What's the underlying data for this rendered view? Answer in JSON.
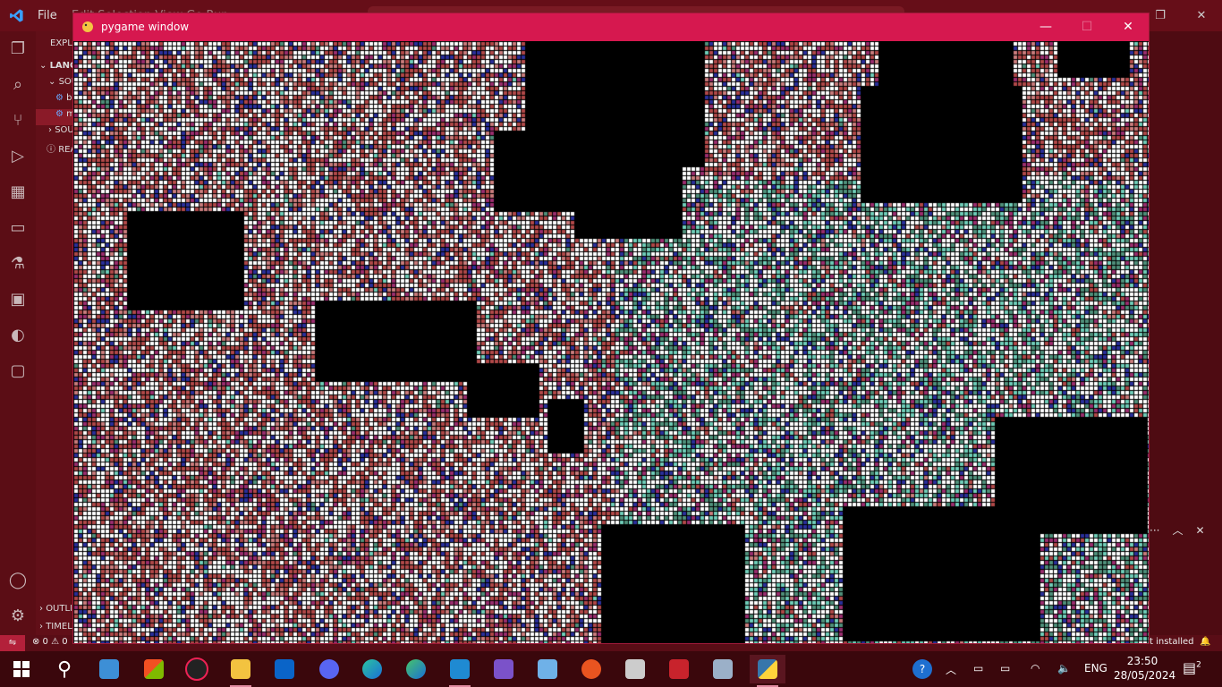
{
  "vscode": {
    "menu_file": "File",
    "menu_hint": "Edit  Selection  View  Go  Run",
    "sidebar": {
      "explorer_label": "EXPLO",
      "section_label": "LANG",
      "rows": [
        "SOU",
        "b",
        "m",
        "SOU",
        "REA"
      ],
      "outline": "OUTLI",
      "timeline": "TIMEL"
    },
    "status": {
      "problems": "⊗ 0 ⚠ 0",
      "right_text": "t installed"
    }
  },
  "pygame": {
    "title": "pygame window",
    "controls": {
      "minimize": "—",
      "maximize": "☐",
      "close": "✕"
    }
  },
  "taskbar": {
    "tray_lang": "ENG",
    "time": "23:50",
    "date": "28/05/2024",
    "notification_count": "2"
  },
  "colors": {
    "pygame_titlebar": "#d6184f",
    "vscode_theme": "#610f18",
    "cell_black": "#000000",
    "cell_red": "#b04848",
    "cell_blue": "#2a2f9a",
    "cell_teal": "#6fcdb8",
    "cell_magenta": "#9a2d6e",
    "cell_white": "#ffffff"
  }
}
